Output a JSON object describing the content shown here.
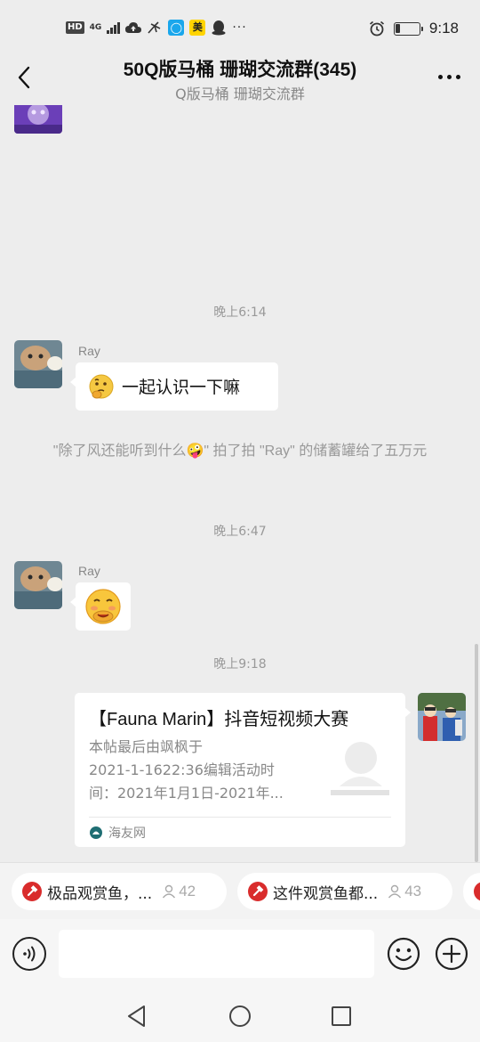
{
  "status_bar": {
    "hd": "HD",
    "network": "4G",
    "app_yellow": "美",
    "more": "···",
    "time": "9:18",
    "battery_level": 0.2
  },
  "header": {
    "title": "50Q版马桶 珊瑚交流群(345)",
    "subtitle": "Q版马桶 珊瑚交流群"
  },
  "messages": {
    "time_1": "晚上6:14",
    "msg_1": {
      "sender": "Ray",
      "emoji": "🤔",
      "text": "一起认识一下嘛"
    },
    "system_notice": "\"除了风还能听到什么🤪\" 拍了拍 \"Ray\" 的储蓄罐给了五万元",
    "time_2": "晚上6:47",
    "msg_2": {
      "sender": "Ray",
      "emoji": "🤭"
    },
    "time_3": "晚上9:18",
    "link_card": {
      "title": "【Fauna Marin】抖音短视频大赛",
      "desc_lines": [
        "本帖最后由飒枫于",
        "2021-1-1622:36编辑活动时",
        "间：2021年1月1日-2021年..."
      ],
      "source": "海友网"
    }
  },
  "group_tabs": [
    {
      "label": "极品观赏鱼，...",
      "count": "42"
    },
    {
      "label": "这件观赏鱼都...",
      "count": "43"
    }
  ],
  "input": {
    "placeholder": ""
  },
  "colors": {
    "background": "#ededed",
    "bubble": "#ffffff",
    "accent_red": "#d92c2c"
  }
}
